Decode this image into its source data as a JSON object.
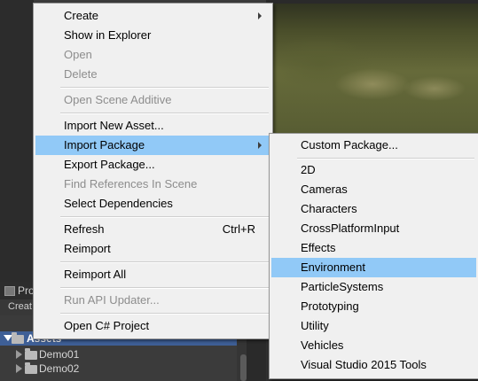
{
  "background": {
    "project_tab_label": "Pro",
    "create_label": "Creat",
    "assets_label": "Assets",
    "tree": [
      {
        "label": "Demo01"
      },
      {
        "label": "Demo02"
      }
    ]
  },
  "context_menu": {
    "items": [
      {
        "label": "Create",
        "submenu": true
      },
      {
        "label": "Show in Explorer"
      },
      {
        "label": "Open",
        "disabled": true
      },
      {
        "label": "Delete",
        "disabled": true
      },
      {
        "label": "Open Scene Additive",
        "disabled": true
      },
      {
        "label": "Import New Asset..."
      },
      {
        "label": "Import Package",
        "submenu": true,
        "highlighted": true
      },
      {
        "label": "Export Package..."
      },
      {
        "label": "Find References In Scene",
        "disabled": true
      },
      {
        "label": "Select Dependencies"
      },
      {
        "label": "Refresh",
        "shortcut": "Ctrl+R"
      },
      {
        "label": "Reimport"
      },
      {
        "label": "Reimport All"
      },
      {
        "label": "Run API Updater...",
        "disabled": true
      },
      {
        "label": "Open C# Project"
      }
    ]
  },
  "import_package_submenu": {
    "items": [
      {
        "label": "Custom Package..."
      },
      {
        "label": "2D"
      },
      {
        "label": "Cameras"
      },
      {
        "label": "Characters"
      },
      {
        "label": "CrossPlatformInput"
      },
      {
        "label": "Effects"
      },
      {
        "label": "Environment",
        "highlighted": true
      },
      {
        "label": "ParticleSystems"
      },
      {
        "label": "Prototyping"
      },
      {
        "label": "Utility"
      },
      {
        "label": "Vehicles"
      },
      {
        "label": "Visual Studio 2015 Tools"
      }
    ]
  },
  "colors": {
    "highlight": "#91c9f7",
    "menu_background": "#f0f0f0",
    "disabled_text": "#8d8d8d",
    "selected_row": "#3e5f96"
  }
}
